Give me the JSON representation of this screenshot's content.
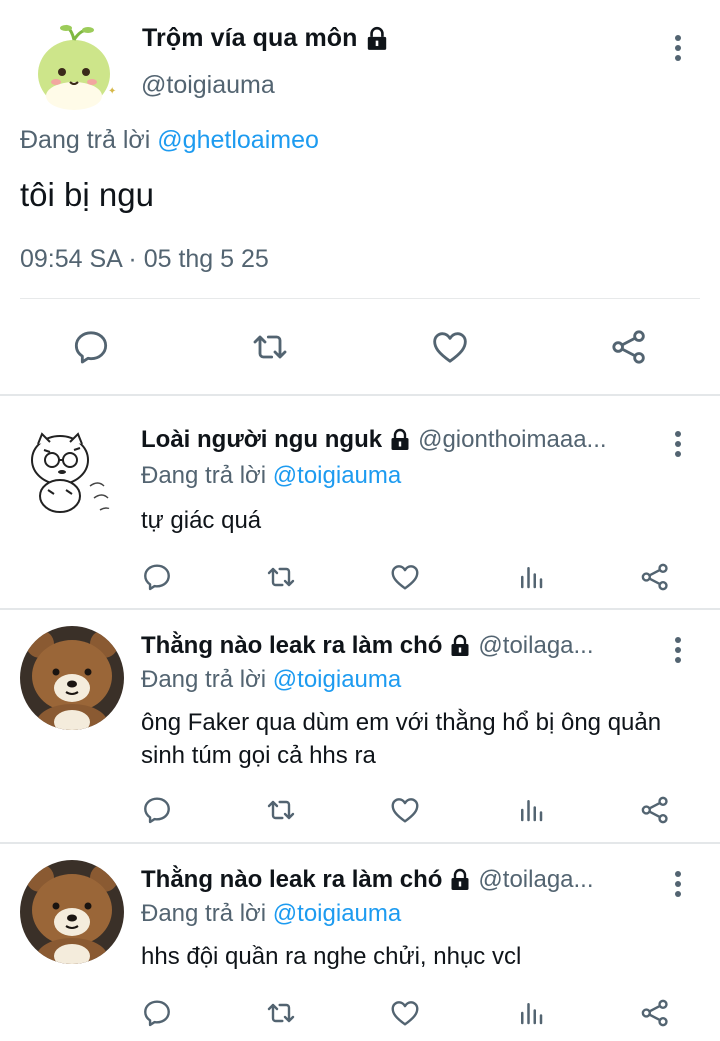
{
  "main": {
    "author_name": "Trộm vía qua môn",
    "author_handle": "@toigiauma",
    "replying_prefix": "Đang trả lời",
    "replying_to": "@ghetloaimeo",
    "text": "tôi bị ngu",
    "timestamp": "09:54 SA · 05 thg 5 25",
    "actions": [
      "reply-icon",
      "retweet-icon",
      "like-icon",
      "share-icon"
    ]
  },
  "replies": [
    {
      "author_name": "Loài người ngu nguk",
      "author_handle": "@gionthoimaaa...",
      "replying_prefix": "Đang trả lời",
      "replying_to": "@toigiauma",
      "text": "tự giác quá"
    },
    {
      "author_name": "Thằng nào leak ra làm chó",
      "author_handle": "@toilaga...",
      "replying_prefix": "Đang trả lời",
      "replying_to": "@toigiauma",
      "text": "ông Faker qua dùm em với thằng hổ bị ông quản sinh túm gọi cả hhs ra"
    },
    {
      "author_name": "Thằng nào leak ra làm chó",
      "author_handle": "@toilaga...",
      "replying_prefix": "Đang trả lời",
      "replying_to": "@toigiauma",
      "text": "hhs đội quần ra nghe chửi, nhục vcl"
    }
  ],
  "colors": {
    "text_primary": "#0f1419",
    "text_secondary": "#536471",
    "link": "#1d9bf0",
    "icon": "#536471",
    "divider": "#e7e9ea"
  }
}
